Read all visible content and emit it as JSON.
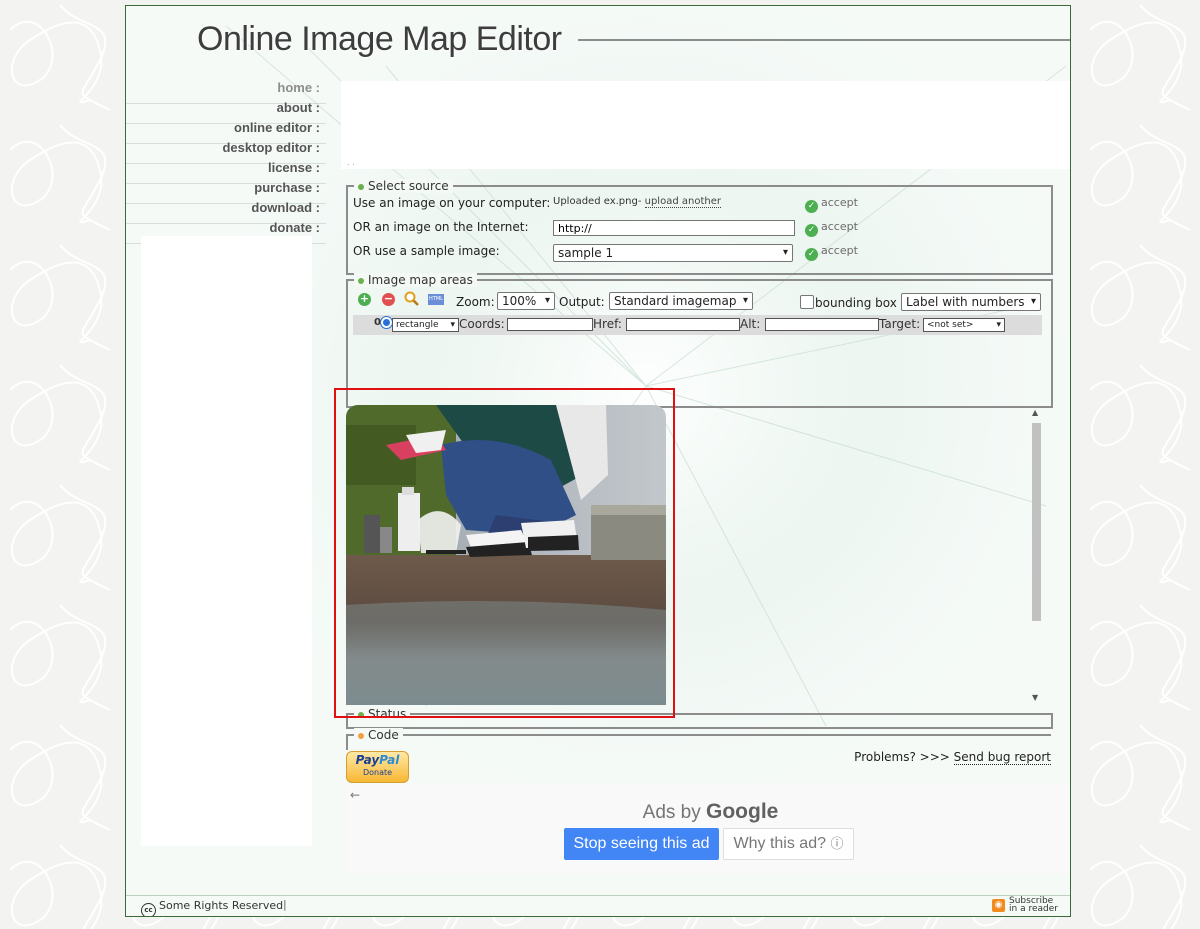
{
  "app": {
    "title": "Online Image Map Editor"
  },
  "nav": [
    {
      "label": "home :"
    },
    {
      "label": "about :"
    },
    {
      "label": "online editor :"
    },
    {
      "label": "desktop editor :"
    },
    {
      "label": "license :"
    },
    {
      "label": "purchase :"
    },
    {
      "label": "download :"
    },
    {
      "label": "donate :"
    }
  ],
  "top_ad": {
    "dots": ". ."
  },
  "select_source": {
    "legend": "Select source",
    "computer_label": "Use an image on your computer:",
    "uploaded_text": "Uploaded ex.png-",
    "upload_another": "upload another",
    "internet_label": "OR an image on the Internet:",
    "internet_value": "http://",
    "sample_label": "OR use a sample image:",
    "sample_selected": "sample 1",
    "accept_label": "accept"
  },
  "image_map_areas": {
    "legend": "Image map areas",
    "zoom_label": "Zoom:",
    "zoom_value": "100%",
    "output_label": "Output:",
    "output_value": "Standard imagemap",
    "bounding_box_label": "bounding box",
    "label_mode_value": "Label with numbers",
    "html_icon_text": "HTML",
    "row": {
      "index": "0",
      "shape": "rectangle",
      "coords_label": "Coords:",
      "href_label": "Href:",
      "alt_label": "Alt:",
      "target_label": "Target:",
      "target_value": "<not set>"
    }
  },
  "status": {
    "legend": "Status"
  },
  "code": {
    "legend": "Code"
  },
  "donate": {
    "pay": "Pay",
    "pal": "Pal",
    "label": "Donate"
  },
  "problems": {
    "text": "Problems? >>> ",
    "link": "Send bug report"
  },
  "bottom_ad": {
    "back_arrow": "←",
    "ads_by": "Ads by",
    "google": "Google",
    "stop": "Stop seeing this ad",
    "why": "Why this ad?",
    "info_icon": "ⓘ"
  },
  "footer": {
    "cc_icon": "cc",
    "rights": "Some Rights Reserved",
    "separator": "|",
    "subscribe_line1": "Subscribe",
    "subscribe_line2": "in a reader"
  },
  "colors": {
    "highlight": "#e01010",
    "accent_green": "#6ab04c",
    "google_blue": "#4285f4"
  }
}
